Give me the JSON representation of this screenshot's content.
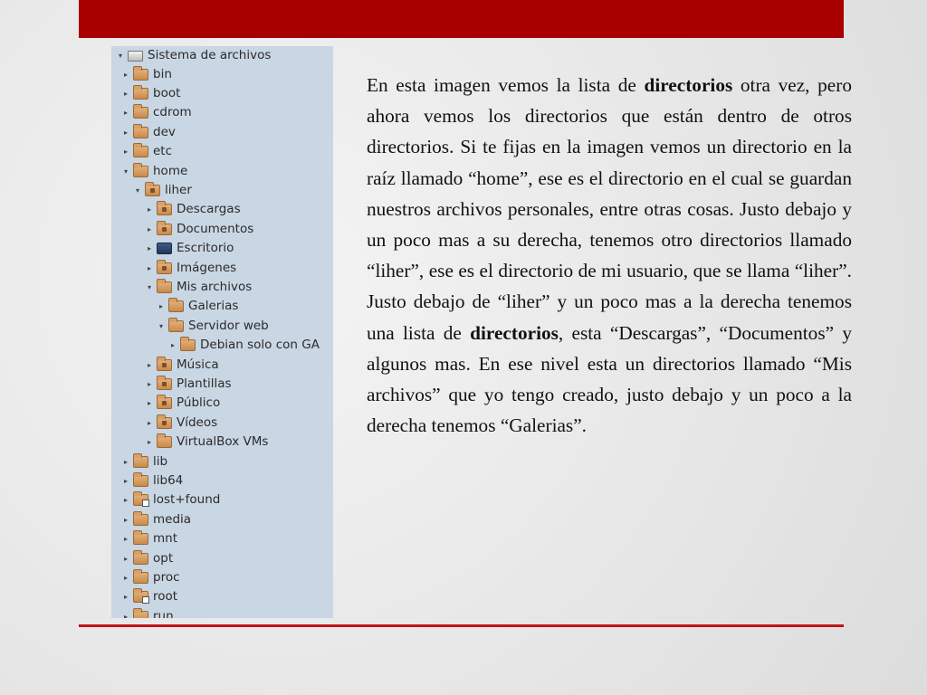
{
  "tree": {
    "root_label": "Sistema de archivos",
    "items": [
      {
        "label": "bin",
        "depth": 0,
        "expander": "▸",
        "icon": "folder-icon"
      },
      {
        "label": "boot",
        "depth": 0,
        "expander": "▸",
        "icon": "folder-icon"
      },
      {
        "label": "cdrom",
        "depth": 0,
        "expander": "▸",
        "icon": "folder-icon"
      },
      {
        "label": "dev",
        "depth": 0,
        "expander": "▸",
        "icon": "folder-icon"
      },
      {
        "label": "etc",
        "depth": 0,
        "expander": "▸",
        "icon": "folder-icon"
      },
      {
        "label": "home",
        "depth": 0,
        "expander": "▾",
        "icon": "folder-icon"
      },
      {
        "label": "liher",
        "depth": 1,
        "expander": "▾",
        "icon": "home-folder-icon"
      },
      {
        "label": "Descargas",
        "depth": 2,
        "expander": "▸",
        "icon": "downloads-folder-icon"
      },
      {
        "label": "Documentos",
        "depth": 2,
        "expander": "▸",
        "icon": "documents-folder-icon"
      },
      {
        "label": "Escritorio",
        "depth": 2,
        "expander": "▸",
        "icon": "desktop-folder-icon"
      },
      {
        "label": "Imágenes",
        "depth": 2,
        "expander": "▸",
        "icon": "pictures-folder-icon"
      },
      {
        "label": "Mis archivos",
        "depth": 2,
        "expander": "▾",
        "icon": "folder-icon"
      },
      {
        "label": "Galerias",
        "depth": 3,
        "expander": "▸",
        "icon": "folder-icon"
      },
      {
        "label": "Servidor web",
        "depth": 3,
        "expander": "▾",
        "icon": "folder-icon"
      },
      {
        "label": "Debian solo con GA",
        "depth": 4,
        "expander": "▸",
        "icon": "folder-icon"
      },
      {
        "label": "Música",
        "depth": 2,
        "expander": "▸",
        "icon": "music-folder-icon"
      },
      {
        "label": "Plantillas",
        "depth": 2,
        "expander": "▸",
        "icon": "templates-folder-icon"
      },
      {
        "label": "Público",
        "depth": 2,
        "expander": "▸",
        "icon": "public-folder-icon"
      },
      {
        "label": "Vídeos",
        "depth": 2,
        "expander": "▸",
        "icon": "videos-folder-icon"
      },
      {
        "label": "VirtualBox VMs",
        "depth": 2,
        "expander": "▸",
        "icon": "folder-icon"
      },
      {
        "label": "lib",
        "depth": 0,
        "expander": "▸",
        "icon": "folder-icon"
      },
      {
        "label": "lib64",
        "depth": 0,
        "expander": "▸",
        "icon": "folder-icon"
      },
      {
        "label": "lost+found",
        "depth": 0,
        "expander": "▸",
        "icon": "locked-folder-icon"
      },
      {
        "label": "media",
        "depth": 0,
        "expander": "▸",
        "icon": "folder-icon"
      },
      {
        "label": "mnt",
        "depth": 0,
        "expander": "▸",
        "icon": "folder-icon"
      },
      {
        "label": "opt",
        "depth": 0,
        "expander": "▸",
        "icon": "folder-icon"
      },
      {
        "label": "proc",
        "depth": 0,
        "expander": "▸",
        "icon": "folder-icon"
      },
      {
        "label": "root",
        "depth": 0,
        "expander": "▸",
        "icon": "locked-folder-icon"
      },
      {
        "label": "run",
        "depth": 0,
        "expander": "▸",
        "icon": "folder-icon"
      }
    ]
  },
  "text": {
    "seg1": "En esta imagen vemos la lista de ",
    "bold1": "directorios",
    "seg2": " otra vez, pero ahora vemos los directorios que están dentro de otros directorios. Si te fijas en la imagen vemos un directorio en la raíz llamado “home”, ese es el directorio en el cual se guardan nuestros archivos personales, entre otras cosas. Justo debajo y un poco mas a su derecha, tenemos otro directorios llamado “liher”, ese es el directorio de mi usuario, que se llama “liher”. Justo debajo de “liher” y un poco mas a la derecha tenemos una lista de ",
    "bold2": "directorios",
    "seg3": ", esta “Descargas”, “Documentos” y algunos mas. En ese nivel esta un directorios llamado “Mis archivos” que yo tengo creado, justo debajo y un poco a la derecha tenemos “Galerias”."
  },
  "colors": {
    "top_bar": "#a80000",
    "bottom_rule": "#c0141a",
    "tree_background": "#c9d6e4"
  }
}
